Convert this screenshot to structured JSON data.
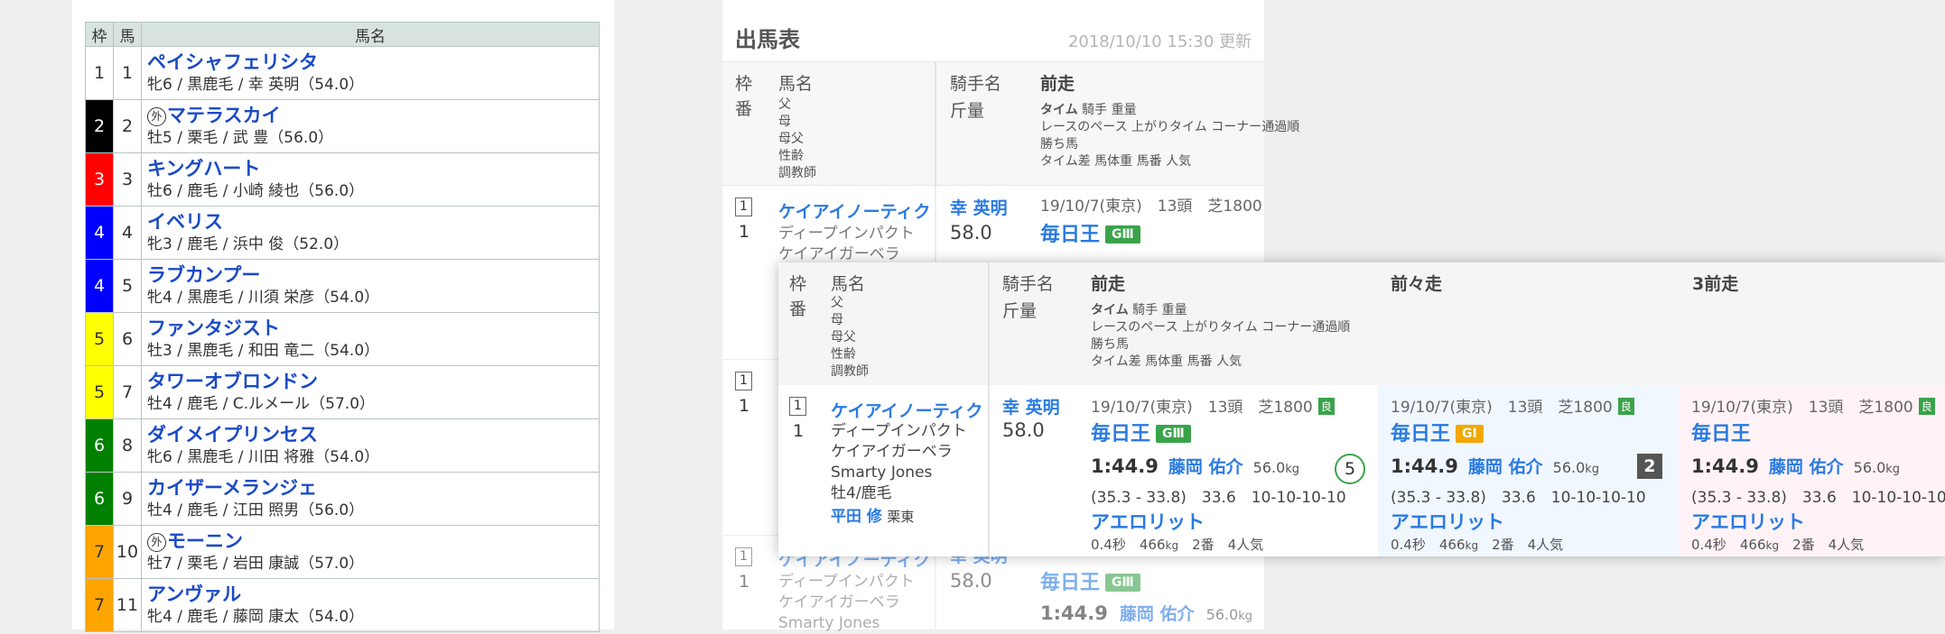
{
  "left_table": {
    "headers": {
      "waku": "枠",
      "uma": "馬",
      "name": "馬名"
    },
    "rows": [
      {
        "waku": "1",
        "umaban": "1",
        "foreign": false,
        "name": "ペイシャフェリシタ",
        "detail": "牝6 / 黒鹿毛 / 幸 英明（54.0）",
        "bg": "#ffffff",
        "fg": "#333333"
      },
      {
        "waku": "2",
        "umaban": "2",
        "foreign": true,
        "name": "マテラスカイ",
        "detail": "牡5 / 栗毛 / 武 豊（56.0）",
        "bg": "#000000",
        "fg": "#ffffff"
      },
      {
        "waku": "3",
        "umaban": "3",
        "foreign": false,
        "name": "キングハート",
        "detail": "牡6 / 鹿毛 / 小崎 綾也（56.0）",
        "bg": "#ff0000",
        "fg": "#ffffff"
      },
      {
        "waku": "4",
        "umaban": "4",
        "foreign": false,
        "name": "イベリス",
        "detail": "牝3 / 鹿毛 / 浜中 俊（52.0）",
        "bg": "#0000ff",
        "fg": "#ffffff"
      },
      {
        "waku": "4",
        "umaban": "5",
        "foreign": false,
        "name": "ラブカンプー",
        "detail": "牝4 / 黒鹿毛 / 川須 栄彦（54.0）",
        "bg": "#0000ff",
        "fg": "#ffffff"
      },
      {
        "waku": "5",
        "umaban": "6",
        "foreign": false,
        "name": "ファンタジスト",
        "detail": "牡3 / 黒鹿毛 / 和田 竜二（54.0）",
        "bg": "#ffff00",
        "fg": "#333333"
      },
      {
        "waku": "5",
        "umaban": "7",
        "foreign": false,
        "name": "タワーオブロンドン",
        "detail": "牡4 / 鹿毛 / C.ルメール（57.0）",
        "bg": "#ffff00",
        "fg": "#333333"
      },
      {
        "waku": "6",
        "umaban": "8",
        "foreign": false,
        "name": "ダイメイプリンセス",
        "detail": "牝6 / 黒鹿毛 / 川田 将雅（54.0）",
        "bg": "#008000",
        "fg": "#ffffff"
      },
      {
        "waku": "6",
        "umaban": "9",
        "foreign": false,
        "name": "カイザーメランジェ",
        "detail": "牡4 / 鹿毛 / 江田 照男（56.0）",
        "bg": "#008000",
        "fg": "#ffffff"
      },
      {
        "waku": "7",
        "umaban": "10",
        "foreign": true,
        "name": "モーニン",
        "detail": "牡7 / 栗毛 / 岩田 康誠（57.0）",
        "bg": "#ffa500",
        "fg": "#333333"
      },
      {
        "waku": "7",
        "umaban": "11",
        "foreign": false,
        "name": "アンヴァル",
        "detail": "牝4 / 鹿毛 / 藤岡 康太（54.0）",
        "bg": "#ffa500",
        "fg": "#333333"
      }
    ]
  },
  "card": {
    "title": "出馬表",
    "updated": "2018/10/10 15:30 更新",
    "header": {
      "waku": "枠",
      "ban": "番",
      "name": "馬名",
      "name_sub": [
        "父",
        "母",
        "母父",
        "性齢",
        "調教師"
      ],
      "jockey": "騎手名",
      "weight": "斤量",
      "prev": "前走",
      "prev2": "前々走",
      "prev3": "3前走",
      "prev_sub_bold": "タイム",
      "prev_sub_rest": " 騎手 重量",
      "prev_sub_lines": [
        "レースのペース 上がりタイム コーナー通過順",
        "勝ち馬",
        "タイム差 馬体重 馬番 人気"
      ]
    },
    "horse": {
      "waku": "1",
      "umaban": "1",
      "name": "ケイアイノーティク",
      "sire": "ディープインパクト",
      "dam": "ケイアイガーベラ",
      "damsire": "Smarty Jones",
      "sexage": "牡4/鹿毛",
      "trainer": "平田 修",
      "trainer_loc": "栗東",
      "jockey": "幸 英明",
      "weight": "58.0"
    },
    "races": [
      {
        "info": "19/10/7(東京)　13頭　芝1800",
        "cond": "良",
        "race": "毎日王",
        "grade": "GⅢ",
        "time": "1:44.9",
        "jockey": "藤岡 佑介",
        "kg": "56.0",
        "unit": "kg",
        "pace": "(35.3 - 33.8)　33.6　10-10-10-10",
        "winner": "アエロリット",
        "diff": "0.4秒",
        "body": "466",
        "horse_no": "2番",
        "pop": "4人気",
        "rank": "5"
      },
      {
        "info": "19/10/7(東京)　13頭　芝1800",
        "cond": "良",
        "race": "毎日王",
        "grade": "GⅠ",
        "time": "1:44.9",
        "jockey": "藤岡 佑介",
        "kg": "56.0",
        "unit": "kg",
        "pace": "(35.3 - 33.8)　33.6　10-10-10-10",
        "winner": "アエロリット",
        "diff": "0.4秒",
        "body": "466",
        "horse_no": "2番",
        "pop": "4人気",
        "rank": "2"
      },
      {
        "info": "19/10/7(東京)　13頭　芝1800",
        "cond": "良",
        "race": "毎日王",
        "grade": "",
        "time": "1:44.9",
        "jockey": "藤岡 佑介",
        "kg": "56.0",
        "unit": "kg",
        "pace": "(35.3 - 33.8)　33.6　10-10-10-10",
        "winner": "アエロリット",
        "diff": "0.4秒",
        "body": "466",
        "horse_no": "2番",
        "pop": "4人気",
        "rank": ""
      }
    ]
  },
  "colors": {
    "link": "#2a7ae2",
    "name_blue": "#1a4ac6",
    "grade_green": "#3aa34a",
    "grade_yellow": "#f1a800"
  }
}
